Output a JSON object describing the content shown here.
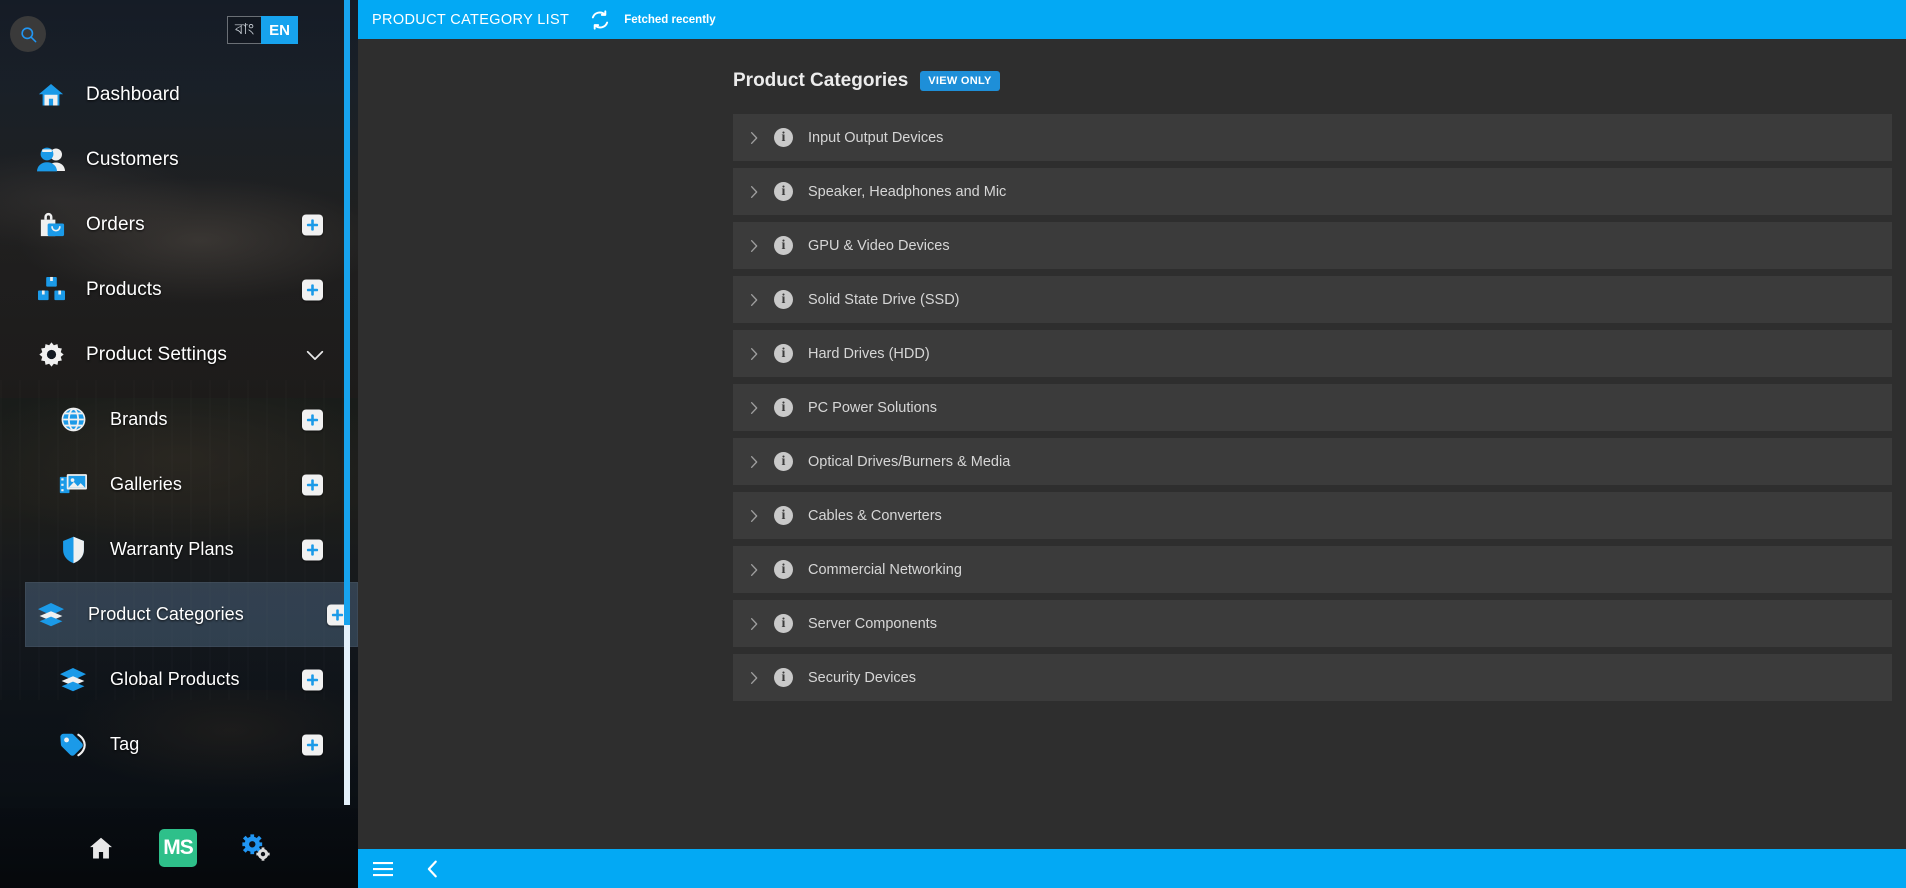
{
  "sidebar": {
    "search_icon": "search-icon",
    "language": {
      "bn_label": "বাং",
      "en_label": "EN"
    },
    "items": [
      {
        "label": "Dashboard",
        "icon": "home-icon",
        "level": "top",
        "add": false,
        "chevron": false,
        "active": false
      },
      {
        "label": "Customers",
        "icon": "users-icon",
        "level": "top",
        "add": false,
        "chevron": false,
        "active": false
      },
      {
        "label": "Orders",
        "icon": "shopping-bag-icon",
        "level": "top",
        "add": true,
        "chevron": false,
        "active": false
      },
      {
        "label": "Products",
        "icon": "boxes-icon",
        "level": "top",
        "add": true,
        "chevron": false,
        "active": false
      },
      {
        "label": "Product Settings",
        "icon": "gear-icon",
        "level": "top",
        "add": false,
        "chevron": true,
        "active": false
      },
      {
        "label": "Brands",
        "icon": "globe-icon",
        "level": "sub",
        "add": true,
        "chevron": false,
        "active": false
      },
      {
        "label": "Galleries",
        "icon": "gallery-icon",
        "level": "sub",
        "add": true,
        "chevron": false,
        "active": false
      },
      {
        "label": "Warranty Plans",
        "icon": "shield-icon",
        "level": "sub",
        "add": true,
        "chevron": false,
        "active": false
      },
      {
        "label": "Product Categories",
        "icon": "layers-icon",
        "level": "sub",
        "add": true,
        "chevron": false,
        "active": true
      },
      {
        "label": "Global Products",
        "icon": "layers-icon",
        "level": "sub",
        "add": true,
        "chevron": false,
        "active": false
      },
      {
        "label": "Tag",
        "icon": "tag-icon",
        "level": "sub",
        "add": true,
        "chevron": false,
        "active": false
      }
    ],
    "bottom_bar": [
      {
        "name": "home-icon",
        "label": "home"
      },
      {
        "name": "ms-logo",
        "label": "MS"
      },
      {
        "name": "gears-icon",
        "label": "settings"
      }
    ]
  },
  "topbar": {
    "title": "PRODUCT CATEGORY LIST",
    "refresh_icon": "refresh-icon",
    "status": "Fetched recently"
  },
  "page": {
    "title": "Product Categories",
    "badge": "VIEW ONLY"
  },
  "categories": [
    {
      "label": "Input Output Devices"
    },
    {
      "label": "Speaker, Headphones and Mic"
    },
    {
      "label": "GPU & Video Devices"
    },
    {
      "label": "Solid State Drive (SSD)"
    },
    {
      "label": "Hard Drives (HDD)"
    },
    {
      "label": "PC Power Solutions"
    },
    {
      "label": "Optical Drives/Burners & Media"
    },
    {
      "label": "Cables & Converters"
    },
    {
      "label": "Commercial Networking"
    },
    {
      "label": "Server Components"
    },
    {
      "label": "Security Devices"
    }
  ],
  "bottombar": {
    "menu_icon": "hamburger-menu-icon",
    "back_icon": "chevron-left-icon"
  },
  "colors": {
    "accent": "#03a9f4",
    "badge": "#1e8fd8",
    "row_bg": "#3b3b3b",
    "content_bg": "#2e2e2e",
    "ms_green": "#2ec08a"
  }
}
